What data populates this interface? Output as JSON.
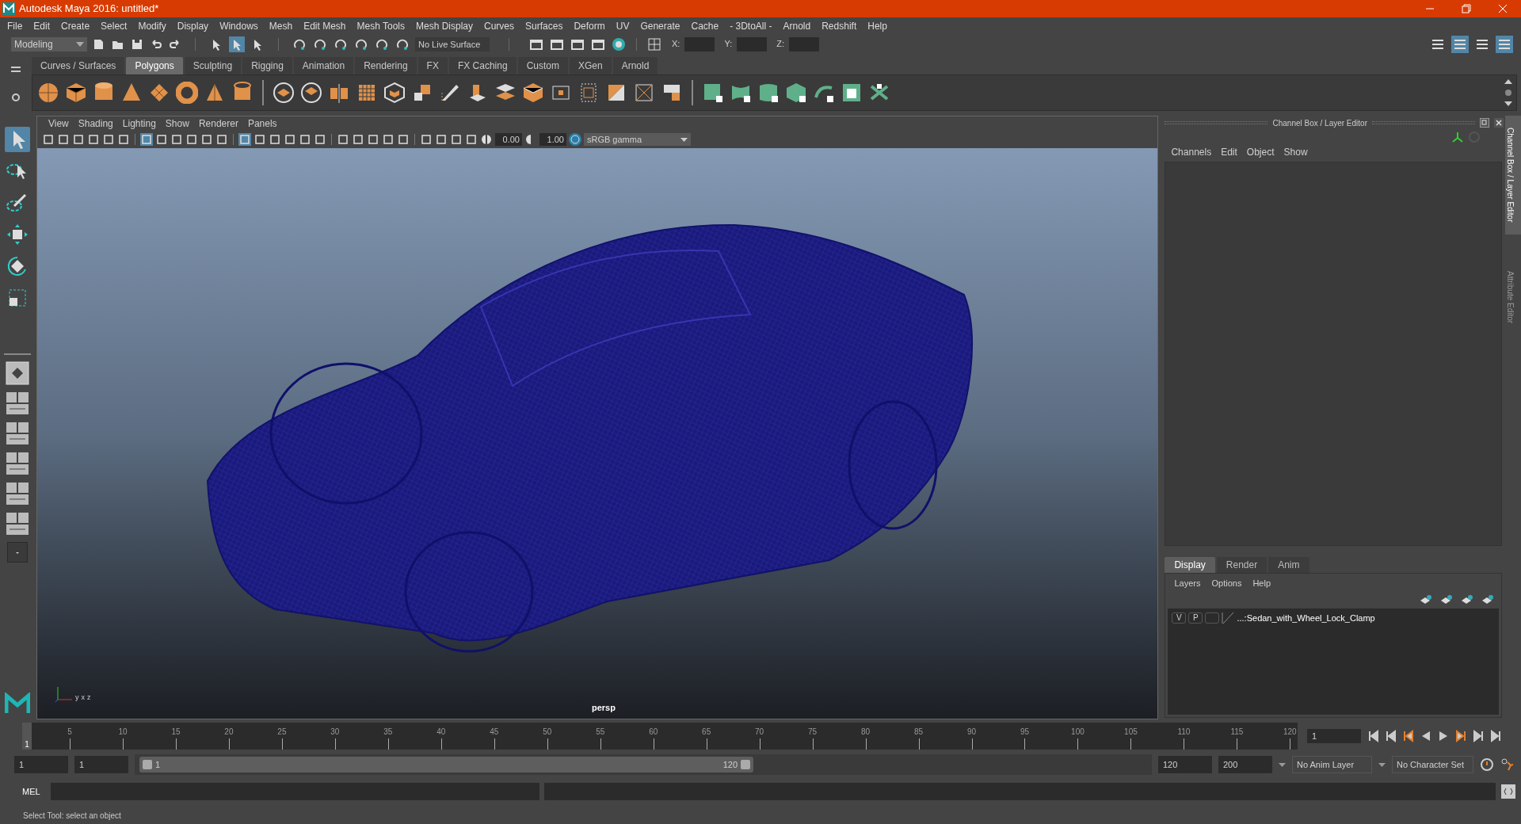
{
  "window": {
    "title": "Autodesk Maya 2016: untitled*"
  },
  "menu_bar": [
    "File",
    "Edit",
    "Create",
    "Select",
    "Modify",
    "Display",
    "Windows",
    "Mesh",
    "Edit Mesh",
    "Mesh Tools",
    "Mesh Display",
    "Curves",
    "Surfaces",
    "Deform",
    "UV",
    "Generate",
    "Cache",
    "- 3DtoAll -",
    "Arnold",
    "Redshift",
    "Help"
  ],
  "status_line": {
    "workspace": "Modeling",
    "live_surface": "No Live Surface",
    "coords": [
      "X:",
      "Y:",
      "Z:"
    ]
  },
  "shelf_tabs": [
    {
      "label": "Curves / Surfaces",
      "selected": false
    },
    {
      "label": "Polygons",
      "selected": true
    },
    {
      "label": "Sculpting",
      "selected": false
    },
    {
      "label": "Rigging",
      "selected": false
    },
    {
      "label": "Animation",
      "selected": false
    },
    {
      "label": "Rendering",
      "selected": false
    },
    {
      "label": "FX",
      "selected": false
    },
    {
      "label": "FX Caching",
      "selected": false
    },
    {
      "label": "Custom",
      "selected": false
    },
    {
      "label": "XGen",
      "selected": false
    },
    {
      "label": "Arnold",
      "selected": false
    }
  ],
  "viewport": {
    "menu": [
      "View",
      "Shading",
      "Lighting",
      "Show",
      "Renderer",
      "Panels"
    ],
    "exposure": "0.00",
    "gamma": "1.00",
    "color_space": "sRGB gamma",
    "axis_labels": [
      "y",
      "x",
      "z"
    ],
    "camera": "persp"
  },
  "channel_box": {
    "title": "Channel Box / Layer Editor",
    "menu": [
      "Channels",
      "Edit",
      "Object",
      "Show"
    ]
  },
  "layer_editor": {
    "tabs": [
      {
        "label": "Display",
        "selected": true
      },
      {
        "label": "Render",
        "selected": false
      },
      {
        "label": "Anim",
        "selected": false
      }
    ],
    "menu": [
      "Layers",
      "Options",
      "Help"
    ],
    "layers": [
      {
        "visible": "V",
        "playback": "P",
        "name": "...:Sedan_with_Wheel_Lock_Clamp"
      }
    ]
  },
  "side_tabs": [
    {
      "label": "Channel Box / Layer Editor",
      "selected": true
    },
    {
      "label": "Attribute Editor",
      "selected": false
    }
  ],
  "time_slider": {
    "ticks": [
      "5",
      "10",
      "15",
      "20",
      "25",
      "30",
      "35",
      "40",
      "45",
      "50",
      "55",
      "60",
      "65",
      "70",
      "75",
      "80",
      "85",
      "90",
      "95",
      "100",
      "105",
      "110",
      "115",
      "120"
    ],
    "current": "1",
    "level": 0,
    "current_field": "1"
  },
  "range_slider": {
    "start": "1",
    "playback_start": "1",
    "slider_start": "1",
    "slider_end": "120",
    "playback_end": "120",
    "end": "200",
    "anim_layer": "No Anim Layer",
    "character_set": "No Character Set"
  },
  "command_line": {
    "label": "MEL"
  },
  "help_line": "Select Tool: select an object"
}
